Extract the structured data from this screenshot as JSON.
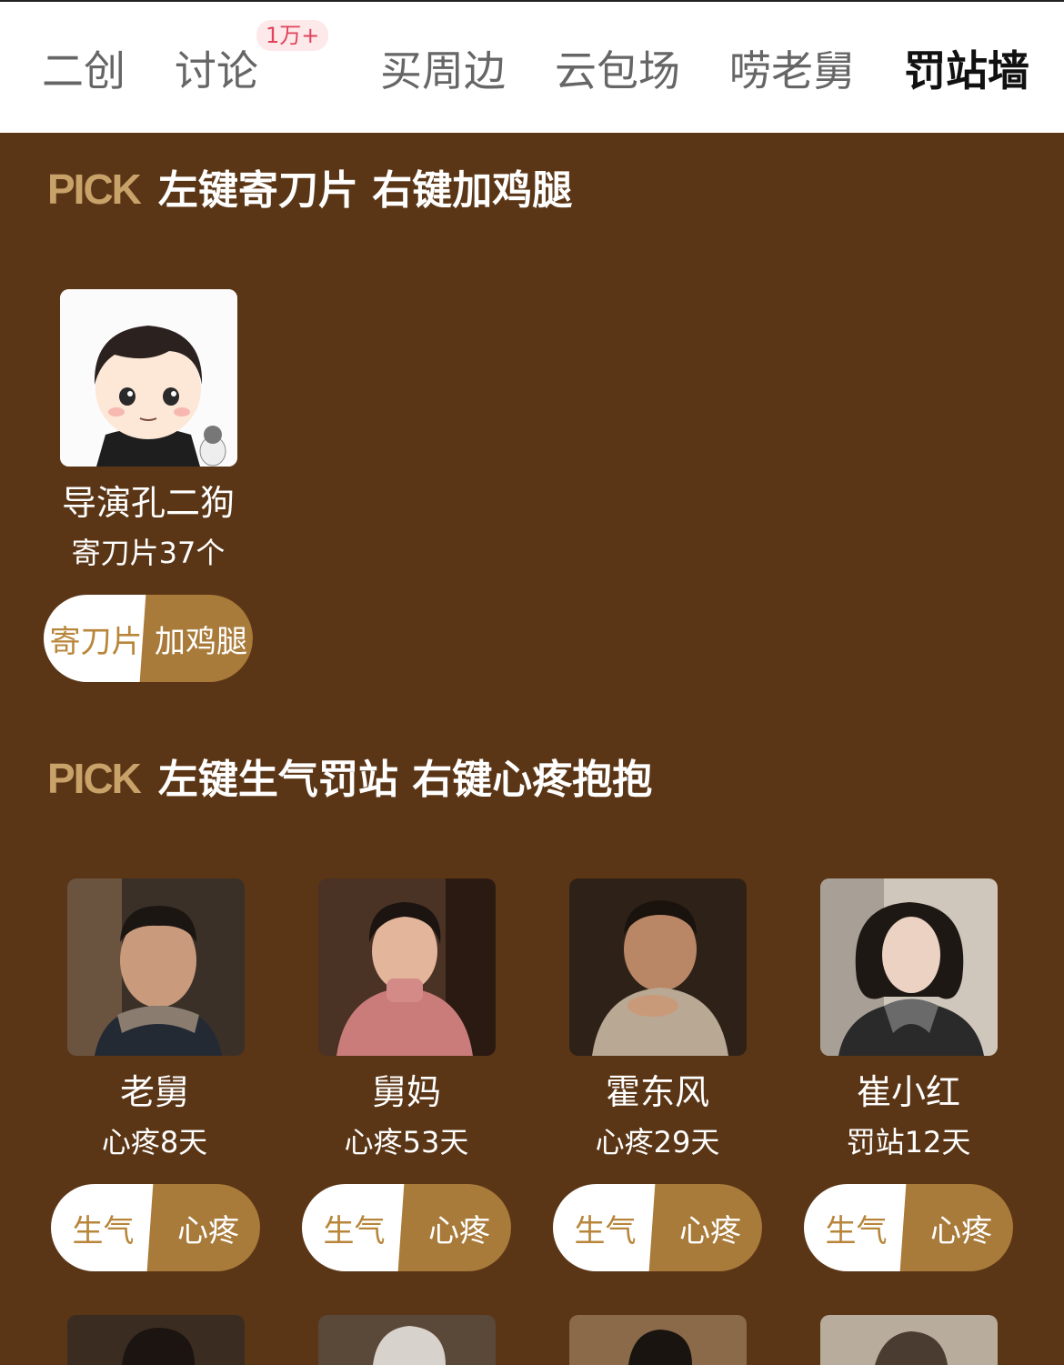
{
  "tabs": [
    {
      "label": "二创",
      "active": false
    },
    {
      "label": "讨论",
      "active": false,
      "badge": "1万+"
    },
    {
      "label": "买周边",
      "active": false
    },
    {
      "label": "云包场",
      "active": false
    },
    {
      "label": "唠老舅",
      "active": false
    },
    {
      "label": "罚站墙",
      "active": true
    }
  ],
  "sections": [
    {
      "pick": "PICK",
      "title": "左键寄刀片 右键加鸡腿",
      "people": [
        {
          "name": "导演孔二狗",
          "stat": "寄刀片37个",
          "left_btn": "寄刀片",
          "right_btn": "加鸡腿",
          "avatar": "cartoon-avatar"
        }
      ]
    },
    {
      "pick": "PICK",
      "title": "左键生气罚站 右键心疼抱抱",
      "people": [
        {
          "name": "老舅",
          "stat": "心疼8天",
          "left_btn": "生气",
          "right_btn": "心疼",
          "avatar": "portrait"
        },
        {
          "name": "舅妈",
          "stat": "心疼53天",
          "left_btn": "生气",
          "right_btn": "心疼",
          "avatar": "portrait"
        },
        {
          "name": "霍东风",
          "stat": "心疼29天",
          "left_btn": "生气",
          "right_btn": "心疼",
          "avatar": "portrait"
        },
        {
          "name": "崔小红",
          "stat": "罚站12天",
          "left_btn": "生气",
          "right_btn": "心疼",
          "avatar": "portrait"
        }
      ]
    }
  ],
  "colors": {
    "background": "#5b3616",
    "accent": "#c9a26a",
    "pill_right": "#a97b3a",
    "pill_left_text": "#b8863a"
  }
}
